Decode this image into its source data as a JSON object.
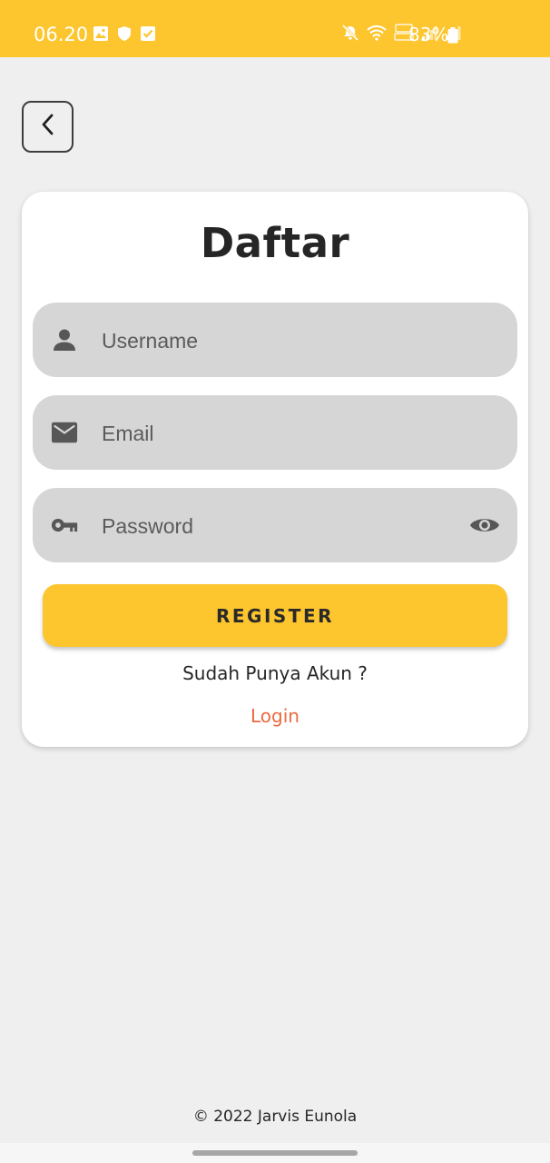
{
  "status_bar": {
    "time": "06.20",
    "battery": "83%",
    "left_icons": [
      "gallery-icon",
      "shield-icon",
      "checkbox-icon"
    ],
    "right_icons": [
      "mute-icon",
      "wifi-icon",
      "volte-icon",
      "signal-icon",
      "signal-icon",
      "battery-icon"
    ]
  },
  "header": {
    "back_icon": "chevron-left-icon"
  },
  "form": {
    "title": "Daftar",
    "username_placeholder": "Username",
    "username_icon": "person-icon",
    "email_placeholder": "Email",
    "email_icon": "mail-icon",
    "password_placeholder": "Password",
    "password_icon": "key-icon",
    "password_toggle_icon": "eye-icon",
    "register_label": "REGISTER",
    "account_question": "Sudah Punya Akun ?",
    "login_label": "Login"
  },
  "footer": {
    "copyright": "© 2022 Jarvis Eunola"
  },
  "colors": {
    "accent": "#fdc52e",
    "background": "#efefef",
    "card": "#ffffff",
    "field": "#d6d6d6",
    "link": "#ea6b3f",
    "text": "#262626"
  }
}
